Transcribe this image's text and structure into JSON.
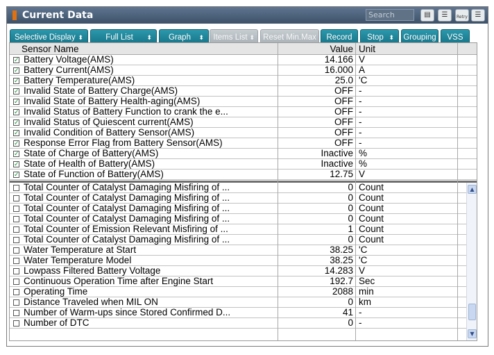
{
  "window": {
    "title": "Current Data"
  },
  "search": {
    "placeholder": "Search"
  },
  "toolbar_icons": [
    {
      "name": "report-icon",
      "glyph": "▤"
    },
    {
      "name": "list-icon",
      "glyph": "☰"
    },
    {
      "name": "retry-icon",
      "glyph": "Retry"
    },
    {
      "name": "menu-icon",
      "glyph": "☰"
    }
  ],
  "toolbar": {
    "selective_display": "Selective Display",
    "full_list": "Full List",
    "graph": "Graph",
    "items_list": "Items List",
    "reset_min_max": "Reset Min.Max",
    "record": "Record",
    "stop": "Stop",
    "grouping": "Grouping",
    "vss": "VSS",
    "spin_glyph": "⬍"
  },
  "columns": {
    "name": "Sensor Name",
    "value": "Value",
    "unit": "Unit"
  },
  "check_glyph": "✓",
  "selected_rows": [
    {
      "name": "Battery Voltage(AMS)",
      "value": "14.166",
      "unit": "V"
    },
    {
      "name": "Battery Current(AMS)",
      "value": "16.000",
      "unit": "A"
    },
    {
      "name": "Battery Temperature(AMS)",
      "value": "25.0",
      "unit": "'C"
    },
    {
      "name": "Invalid State of Battery Charge(AMS)",
      "value": "OFF",
      "unit": "-"
    },
    {
      "name": "Invalid State of Battery Health-aging(AMS)",
      "value": "OFF",
      "unit": "-"
    },
    {
      "name": "Invalid Status of Battery Function to crank the e...",
      "value": "OFF",
      "unit": "-"
    },
    {
      "name": "Invalid Status of Quiescent current(AMS)",
      "value": "OFF",
      "unit": "-"
    },
    {
      "name": "Invalid Condition of Battery Sensor(AMS)",
      "value": "OFF",
      "unit": "-"
    },
    {
      "name": "Response Error Flag from Battery Sensor(AMS)",
      "value": "OFF",
      "unit": "-"
    },
    {
      "name": "State of Charge of Battery(AMS)",
      "value": "Inactive",
      "unit": "%"
    },
    {
      "name": "State of Health of Battery(AMS)",
      "value": "Inactive",
      "unit": "%"
    },
    {
      "name": "State of Function of Battery(AMS)",
      "value": "12.75",
      "unit": "V"
    }
  ],
  "other_rows": [
    {
      "name": "Total Counter of Catalyst Damaging Misfiring of ...",
      "value": "0",
      "unit": "Count"
    },
    {
      "name": "Total Counter of Catalyst Damaging Misfiring of ...",
      "value": "0",
      "unit": "Count"
    },
    {
      "name": "Total Counter of Catalyst Damaging Misfiring of ...",
      "value": "0",
      "unit": "Count"
    },
    {
      "name": "Total Counter of Catalyst Damaging Misfiring of ...",
      "value": "0",
      "unit": "Count"
    },
    {
      "name": "Total Counter of Emission Relevant Misfiring of ...",
      "value": "1",
      "unit": "Count"
    },
    {
      "name": "Total Counter of Catalyst Damaging Misfiring of ...",
      "value": "0",
      "unit": "Count"
    },
    {
      "name": "Water Temperature at Start",
      "value": "38.25",
      "unit": "'C"
    },
    {
      "name": "Water Temperature Model",
      "value": "38.25",
      "unit": "'C"
    },
    {
      "name": "Lowpass Filtered Battery Voltage",
      "value": "14.283",
      "unit": "V"
    },
    {
      "name": "Continuous Operation Time after Engine Start",
      "value": "192.7",
      "unit": "Sec"
    },
    {
      "name": "Operating Time",
      "value": "2088",
      "unit": "min"
    },
    {
      "name": "Distance Traveled when MIL ON",
      "value": "0",
      "unit": "km"
    },
    {
      "name": "Number of Warm-ups since Stored Confirmed D...",
      "value": "41",
      "unit": "-"
    },
    {
      "name": "Number of DTC",
      "value": "0",
      "unit": "-"
    }
  ],
  "scrollbar": {
    "up_glyph": "▲",
    "down_glyph": "▼"
  },
  "colors": {
    "accent_teal": "#1a7f92",
    "title_bar": "#4a5f78",
    "title_marker": "#e07010",
    "check_green": "#0a8a2a"
  }
}
